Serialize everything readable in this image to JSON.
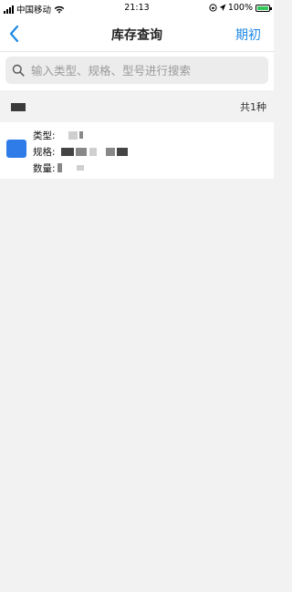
{
  "status_bar": {
    "carrier": "中国移动",
    "time": "21:13",
    "battery": "100%"
  },
  "nav": {
    "title": "库存查询",
    "right_label": "期初"
  },
  "search": {
    "placeholder": "输入类型、规格、型号进行搜索",
    "value": ""
  },
  "summary": {
    "count_label": "共1种"
  },
  "item": {
    "type_label": "类型:",
    "spec_label": "规格:",
    "qty_label": "数量:"
  },
  "colors": {
    "accent": "#1e88e5",
    "item_icon": "#2f7ce8"
  },
  "icons": {
    "back": "chevron-left-icon",
    "search": "search-icon",
    "wifi": "wifi-icon",
    "battery": "battery-icon",
    "location": "location-icon",
    "lock": "rotation-lock-icon"
  }
}
